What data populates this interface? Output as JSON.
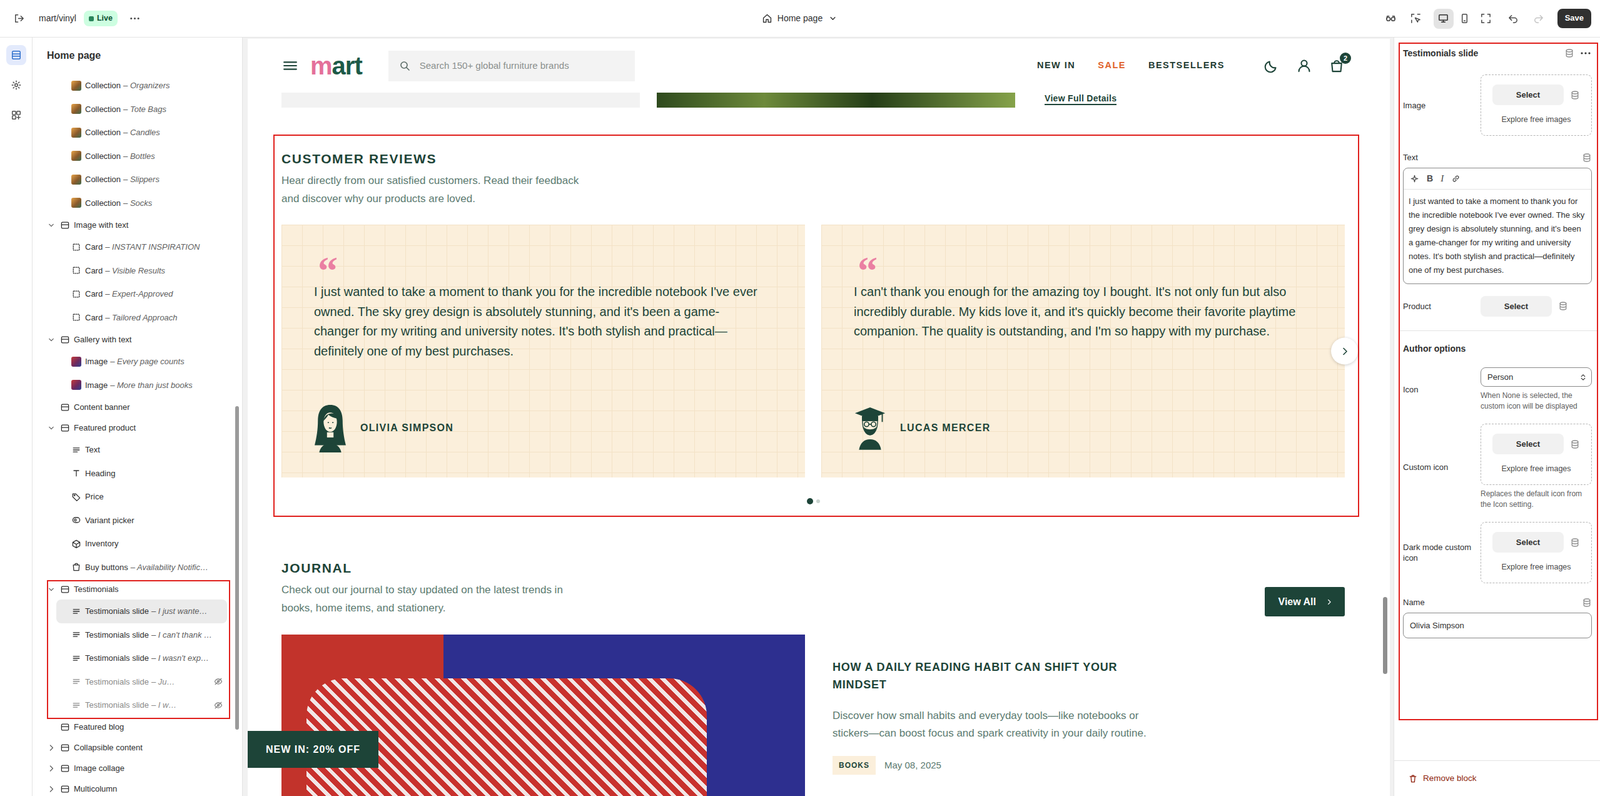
{
  "topbar": {
    "store": "mart/vinyl",
    "status": "Live",
    "page": "Home page",
    "views": [
      {
        "selected": true
      },
      {
        "selected": false
      },
      {
        "selected": false
      }
    ],
    "undo": {
      "disabled": false
    },
    "redo": {
      "disabled": true
    },
    "save": "Save"
  },
  "rail": [
    {
      "selected": true
    },
    {
      "selected": false
    },
    {
      "selected": false
    }
  ],
  "sidebar": {
    "title": "Home page",
    "items": [
      {
        "label": "Collection",
        "suffix": "– Organizers",
        "kind": "collection",
        "selected": false,
        "hidden": false,
        "highlighted": false
      },
      {
        "label": "Collection",
        "suffix": "– Tote Bags",
        "kind": "collection",
        "selected": false,
        "hidden": false,
        "highlighted": false
      },
      {
        "label": "Collection",
        "suffix": "– Candles",
        "kind": "collection",
        "selected": false,
        "hidden": false,
        "highlighted": false
      },
      {
        "label": "Collection",
        "suffix": "– Bottles",
        "kind": "collection",
        "selected": false,
        "hidden": false,
        "highlighted": false
      },
      {
        "label": "Collection",
        "suffix": "– Slippers",
        "kind": "collection",
        "selected": false,
        "hidden": false,
        "highlighted": false
      },
      {
        "label": "Collection",
        "suffix": "– Socks",
        "kind": "collection",
        "selected": false,
        "hidden": false,
        "highlighted": false
      },
      {
        "label": "Image with text",
        "kind": "group",
        "expanded": true,
        "selected": false,
        "hidden": false,
        "highlighted": false
      },
      {
        "label": "Card",
        "suffix": "– INSTANT INSPIRATION",
        "kind": "card",
        "selected": false,
        "hidden": false,
        "highlighted": false
      },
      {
        "label": "Card",
        "suffix": "– Visible Results",
        "kind": "card",
        "selected": false,
        "hidden": false,
        "highlighted": false
      },
      {
        "label": "Card",
        "suffix": "– Expert-Approved",
        "kind": "card",
        "selected": false,
        "hidden": false,
        "highlighted": false
      },
      {
        "label": "Card",
        "suffix": "– Tailored Approach",
        "kind": "card",
        "selected": false,
        "hidden": false,
        "highlighted": false
      },
      {
        "label": "Gallery with text",
        "kind": "group",
        "expanded": true,
        "selected": false,
        "hidden": false,
        "highlighted": false
      },
      {
        "label": "Image",
        "suffix": "– Every page counts",
        "kind": "image",
        "selected": false,
        "hidden": false,
        "highlighted": false
      },
      {
        "label": "Image",
        "suffix": "– More than just books",
        "kind": "image",
        "selected": false,
        "hidden": false,
        "highlighted": false
      },
      {
        "label": "Content banner",
        "kind": "section",
        "selected": false,
        "hidden": false,
        "highlighted": false
      },
      {
        "label": "Featured product",
        "kind": "group",
        "expanded": true,
        "selected": false,
        "hidden": false,
        "highlighted": false
      },
      {
        "label": "Text",
        "kind": "text",
        "selected": false,
        "hidden": false,
        "highlighted": false
      },
      {
        "label": "Heading",
        "kind": "heading",
        "selected": false,
        "hidden": false,
        "highlighted": false
      },
      {
        "label": "Price",
        "kind": "price",
        "selected": false,
        "hidden": false,
        "highlighted": false
      },
      {
        "label": "Variant picker",
        "kind": "picker",
        "selected": false,
        "hidden": false,
        "highlighted": false
      },
      {
        "label": "Inventory",
        "kind": "inventory",
        "selected": false,
        "hidden": false,
        "highlighted": false
      },
      {
        "label": "Buy buttons",
        "suffix": "– Availability Notific…",
        "kind": "buy",
        "selected": false,
        "hidden": false,
        "highlighted": false
      },
      {
        "label": "Testimonials",
        "kind": "group",
        "expanded": true,
        "selected": false,
        "hidden": false,
        "highlighted": true
      },
      {
        "label": "Testimonials slide",
        "suffix": "– I just wante…",
        "kind": "slide",
        "selected": true,
        "hidden": false,
        "highlighted": true
      },
      {
        "label": "Testimonials slide",
        "suffix": "– I can't thank …",
        "kind": "slide",
        "selected": false,
        "hidden": false,
        "highlighted": true
      },
      {
        "label": "Testimonials slide",
        "suffix": "– I wasn't exp…",
        "kind": "slide",
        "selected": false,
        "hidden": false,
        "highlighted": true
      },
      {
        "label": "Testimonials slide",
        "suffix": "– Ju…",
        "kind": "slide",
        "selected": false,
        "hidden": true,
        "highlighted": true
      },
      {
        "label": "Testimonials slide",
        "suffix": "– I w…",
        "kind": "slide",
        "selected": false,
        "hidden": true,
        "highlighted": true
      },
      {
        "label": "Featured blog",
        "kind": "section",
        "selected": false,
        "hidden": false,
        "highlighted": false
      },
      {
        "label": "Collapsible content",
        "kind": "group",
        "expanded": false,
        "selected": false,
        "hidden": false,
        "highlighted": false
      },
      {
        "label": "Image collage",
        "kind": "group",
        "expanded": false,
        "selected": false,
        "hidden": false,
        "highlighted": false
      },
      {
        "label": "Multicolumn",
        "kind": "group",
        "expanded": false,
        "selected": false,
        "hidden": false,
        "highlighted": false
      }
    ]
  },
  "preview": {
    "header": {
      "logo": "mart",
      "search": "Search 150+ global furniture brands",
      "nav": [
        {
          "label": "NEW IN",
          "color": "#1f3b32"
        },
        {
          "label": "SALE",
          "color": "#e0622b"
        },
        {
          "label": "BESTSELLERS",
          "color": "#1f3b32"
        }
      ],
      "cart_count": "2"
    },
    "product_link": "View Full Details",
    "reviews": {
      "title": "CUSTOMER REVIEWS",
      "subtitle": "Hear directly from our satisfied customers. Read their feedback and discover why our products are loved.",
      "slides": [
        {
          "quote": "“",
          "text": "I just wanted to take a moment to thank you for the incredible notebook I've ever owned. The sky grey design is absolutely stunning, and it's been a game-changer for my writing and university notes. It's both stylish and practical—definitely one of my best purchases.",
          "author": "OLIVIA SIMPSON"
        },
        {
          "quote": "“",
          "text": "I can't thank you enough for the amazing toy I bought. It's not only fun but also incredibly durable. My kids love it, and it's quickly become their favorite playtime companion. The quality is outstanding, and I'm so happy with my purchase.",
          "author": "LUCAS MERCER"
        }
      ],
      "dots": [
        {
          "selected": true
        },
        {
          "selected": false
        }
      ]
    },
    "journal": {
      "title": "JOURNAL",
      "subtitle": "Check out our journal to stay updated on the latest trends in books, home items, and stationery.",
      "button": "View All",
      "article": {
        "title": "HOW A DAILY READING HABIT CAN SHIFT YOUR MINDSET",
        "excerpt": "Discover how small habits and everyday tools—like notebooks or stickers—can boost focus and spark creativity in your daily routine.",
        "tag": "BOOKS",
        "date": "May 08, 2025"
      }
    },
    "promo": "NEW IN: 20% OFF"
  },
  "inspector": {
    "title": "Testimonials slide",
    "fields": [
      {
        "kind": "image",
        "label": "Image",
        "button": "Select",
        "explore": "Explore free images"
      },
      {
        "kind": "richtext",
        "label": "Text",
        "toolbar": [
          "B",
          "I"
        ],
        "value": "I just wanted to take a moment to thank you for the incredible notebook I've ever owned. The sky grey design is absolutely stunning, and it's been a game-changer for my writing and university notes. It's both stylish and practical—definitely one of my best purchases."
      },
      {
        "kind": "product",
        "label": "Product",
        "button": "Select"
      },
      {
        "kind": "heading",
        "label": "Author options"
      },
      {
        "kind": "select",
        "label": "Icon",
        "value": "Person",
        "help": "When None is selected, the custom icon will be displayed"
      },
      {
        "kind": "image",
        "label": "Custom icon",
        "button": "Select",
        "explore": "Explore free images",
        "help": "Replaces the default icon from the Icon setting."
      },
      {
        "kind": "image",
        "label": "Dark mode custom icon",
        "button": "Select",
        "explore": "Explore free images"
      },
      {
        "kind": "text",
        "label": "Name",
        "value": "Olivia Simpson"
      }
    ],
    "remove": "Remove block"
  }
}
